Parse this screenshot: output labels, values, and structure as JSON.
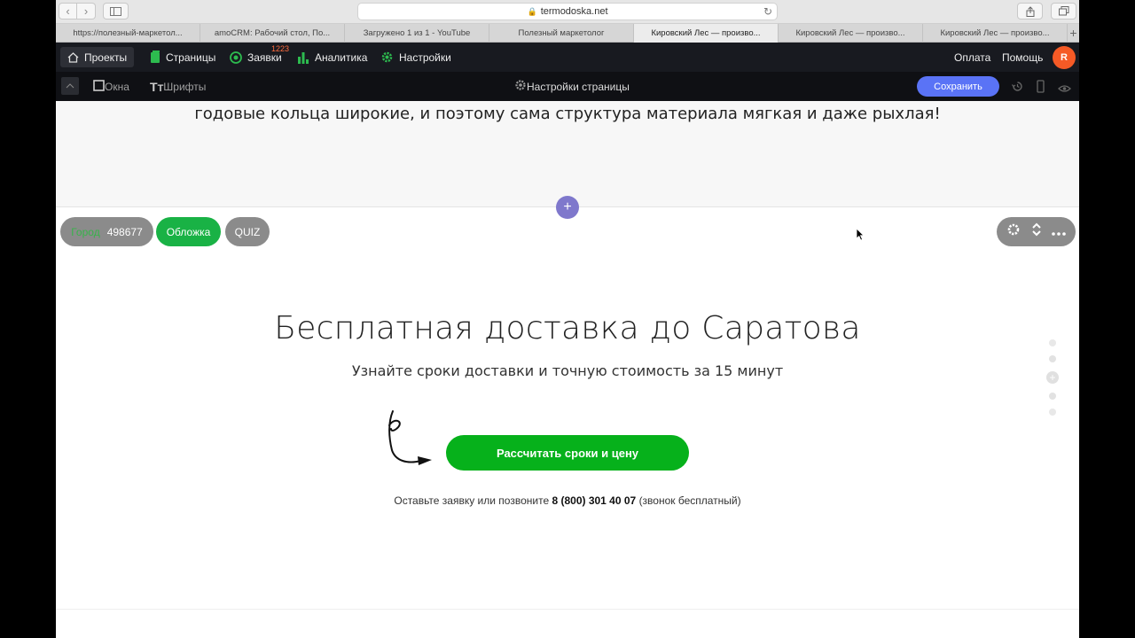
{
  "browser": {
    "url": "termodoska.net",
    "tabs": [
      {
        "title": "https://полезный-маркетол..."
      },
      {
        "title": "amoCRM: Рабочий стол, По..."
      },
      {
        "title": "Загружено 1 из 1 - YouTube"
      },
      {
        "title": "Полезный маркетолог"
      },
      {
        "title": "Кировский Лес — произво..."
      },
      {
        "title": "Кировский Лес — произво..."
      },
      {
        "title": "Кировский Лес — произво..."
      }
    ],
    "active_tab_index": 4
  },
  "topbar": {
    "projects": "Проекты",
    "pages": "Страницы",
    "leads": "Заявки",
    "leads_count": "1223",
    "analytics": "Аналитика",
    "settings": "Настройки",
    "payment": "Оплата",
    "help": "Помощь",
    "avatar_letter": "R"
  },
  "subbar": {
    "windows": "Окна",
    "fonts": "Шрифты",
    "page_settings": "Настройки страницы",
    "save": "Сохранить"
  },
  "content": {
    "top_text": "годовые кольца широкие, и поэтому сама структура материала мягкая и даже рыхлая!",
    "city_label": "Город",
    "city_value": "498677",
    "cover_label": "Обложка",
    "quiz_label": "QUIZ",
    "headline": "Бесплатная доставка до Саратова",
    "subline": "Узнайте сроки доставки и точную стоимость за 15 минут",
    "cta": "Рассчитать сроки и цену",
    "note_prefix": "Оставьте заявку или позвоните",
    "note_phone": "8 (800) 301 40 07",
    "note_suffix": "(звонок бесплатный)"
  },
  "colors": {
    "accent_green": "#06b11b",
    "save_blue": "#5a73f6",
    "avatar_orange": "#f55a26",
    "add_purple": "#7f78cc"
  }
}
